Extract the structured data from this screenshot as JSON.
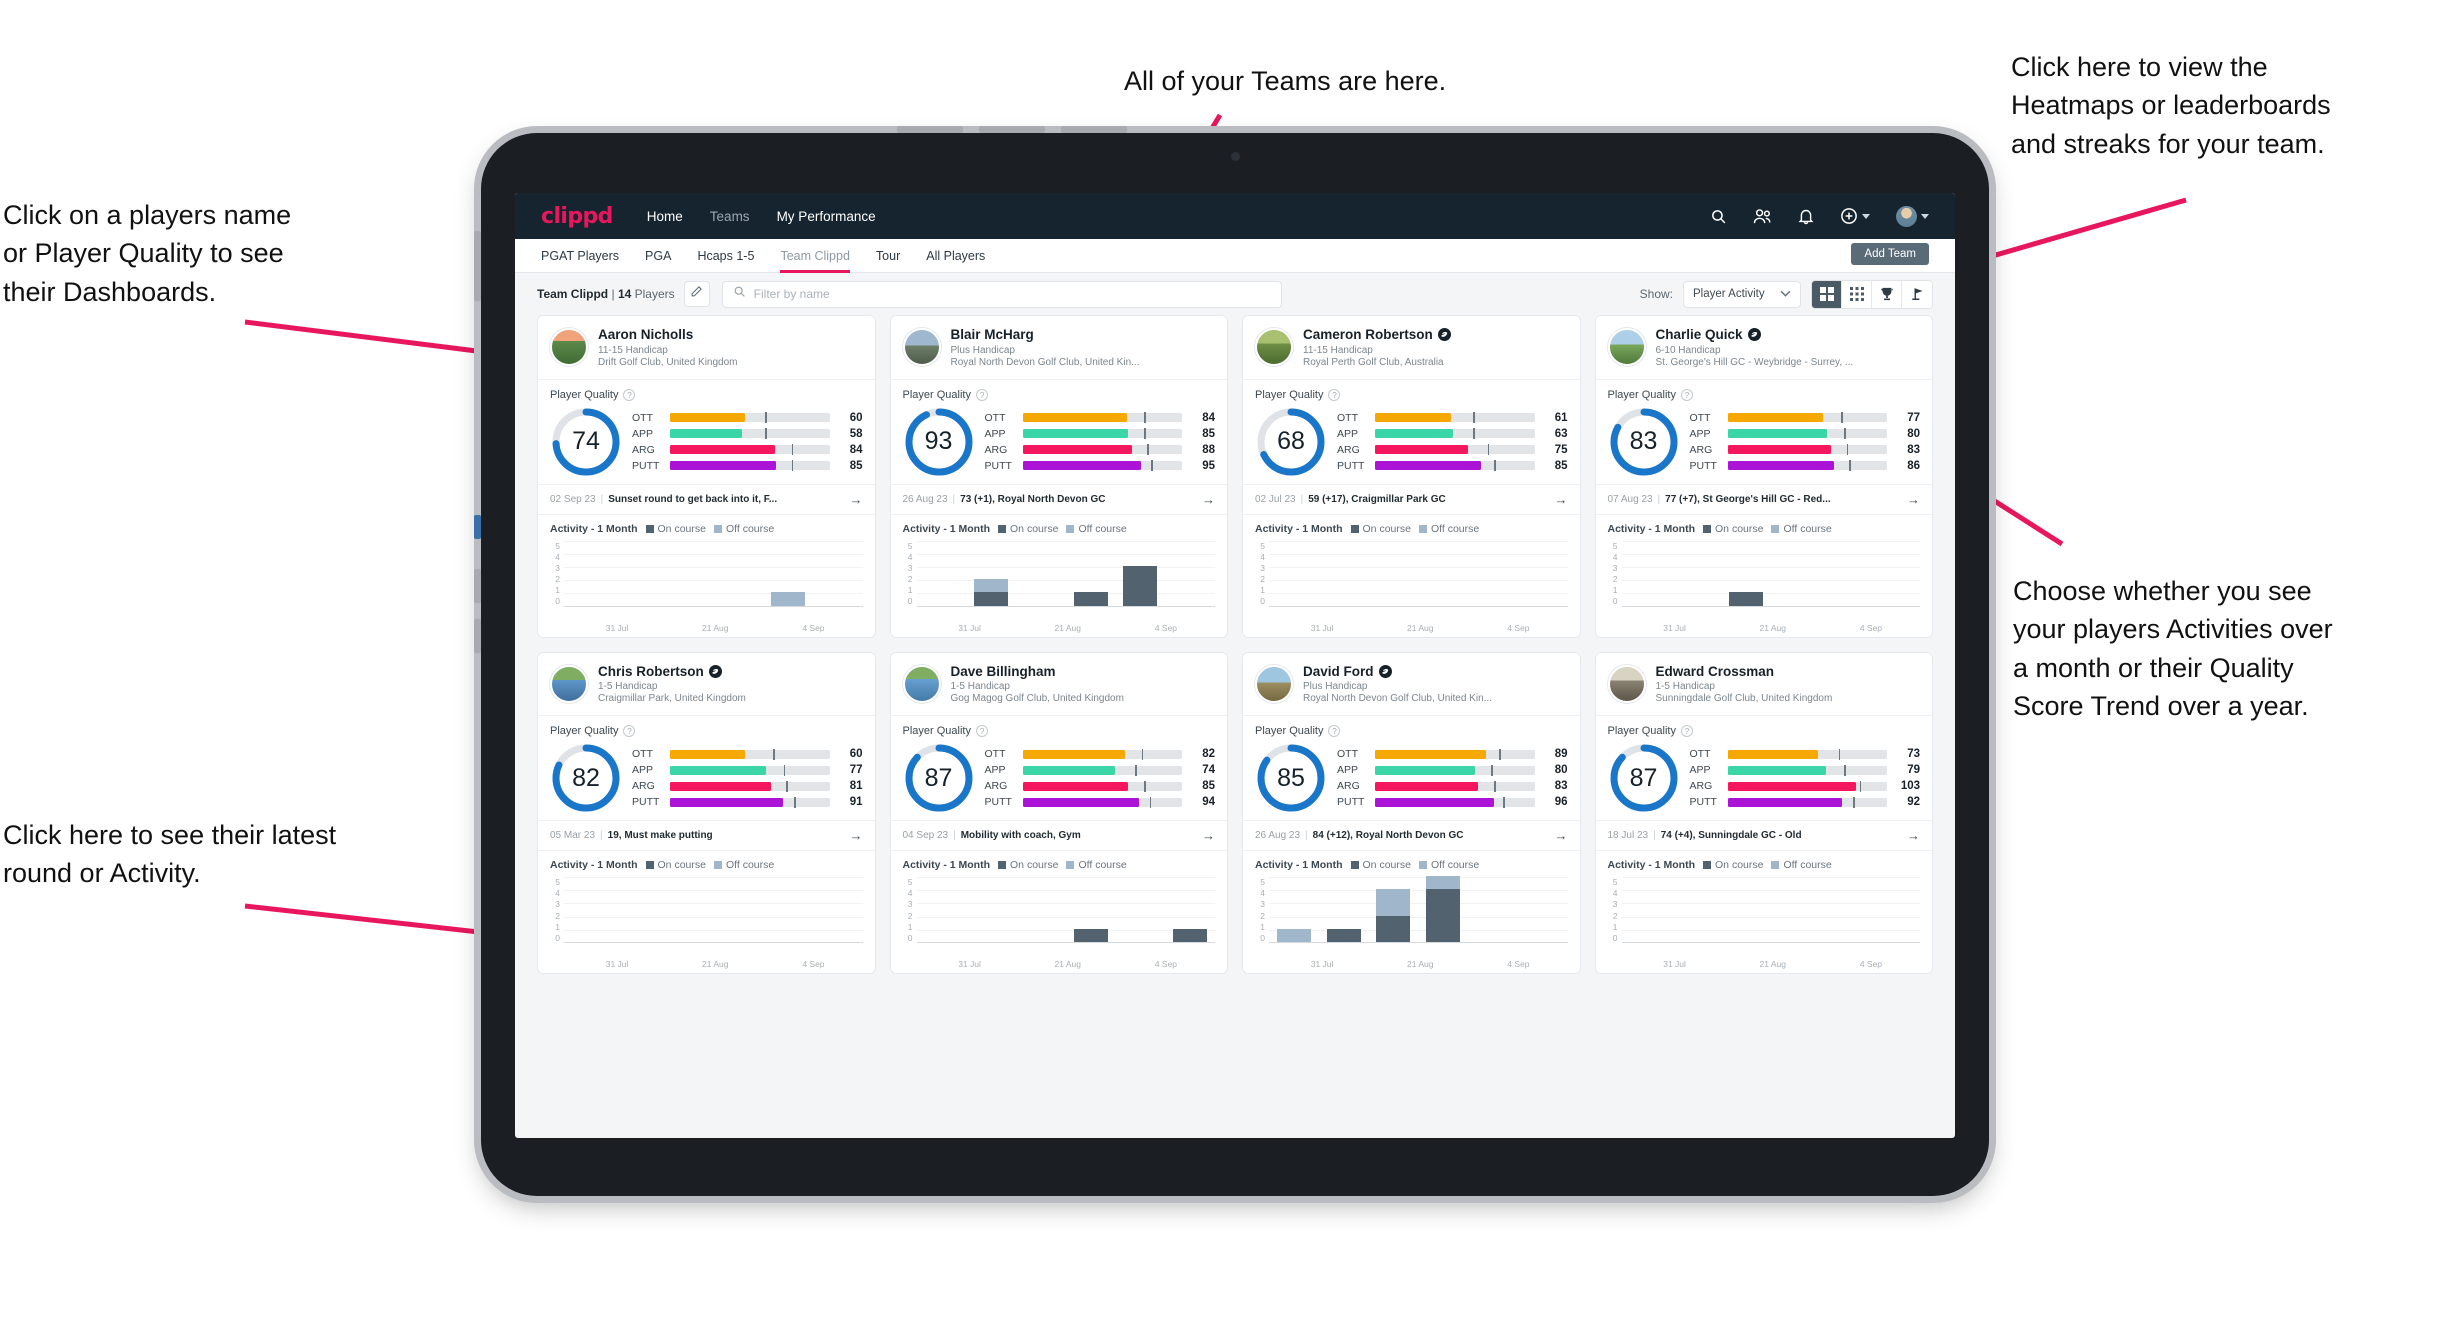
{
  "annotations": [
    {
      "id": "teams",
      "text": "All of your Teams are here."
    },
    {
      "id": "heatmaps",
      "text": "Click here to view the\nHeatmaps or leaderboards\nand streaks for your team."
    },
    {
      "id": "players",
      "text": "Click on a players name\nor Player Quality to see\ntheir Dashboards."
    },
    {
      "id": "activity",
      "text": "Choose whether you see\nyour players Activities over\na month or their Quality\nScore Trend over a year."
    },
    {
      "id": "latest",
      "text": "Click here to see their latest\nround or Activity."
    }
  ],
  "topnav": {
    "logo": "clippd",
    "links": [
      {
        "label": "Home",
        "active": true
      },
      {
        "label": "Teams",
        "active": false
      },
      {
        "label": "My Performance",
        "active": true
      }
    ],
    "icons": [
      "search-icon",
      "people-icon",
      "bell-icon",
      "plus-circle-icon",
      "avatar-icon"
    ]
  },
  "subnav": {
    "tabs": [
      {
        "label": "PGAT Players",
        "active": false
      },
      {
        "label": "PGA",
        "active": false
      },
      {
        "label": "Hcaps 1-5",
        "active": false
      },
      {
        "label": "Team Clippd",
        "active": true
      },
      {
        "label": "Tour",
        "active": false
      },
      {
        "label": "All Players",
        "active": false
      }
    ],
    "add_team_label": "Add Team"
  },
  "toolbar": {
    "team_name": "Team Clippd",
    "separator": "|",
    "player_count": "14",
    "players_word": "Players",
    "edit_icon": "pencil-icon",
    "search_placeholder": "Filter by name",
    "search_value": "",
    "show_label": "Show:",
    "show_value": "Player Activity",
    "views": [
      {
        "name": "grid-large-view",
        "active": true
      },
      {
        "name": "grid-small-view",
        "active": false
      },
      {
        "name": "trophy-view",
        "active": false
      },
      {
        "name": "flag-view",
        "active": false
      }
    ]
  },
  "card_labels": {
    "player_quality": "Player Quality",
    "activity": "Activity - 1 Month",
    "legend_on": "On course",
    "legend_off": "Off course",
    "metrics": [
      "OTT",
      "APP",
      "ARG",
      "PUTT"
    ],
    "x_labels": [
      "31 Jul",
      "21 Aug",
      "4 Sep"
    ],
    "y_labels": [
      "5",
      "4",
      "3",
      "2",
      "1",
      "0"
    ]
  },
  "colors": {
    "brand": "#e8175d",
    "nav_bg": "#16242f",
    "ring": "#1a76c8",
    "ott": "#f5a800",
    "app": "#3ad6a8",
    "arg": "#f5175e",
    "putt": "#ab13d6",
    "on_course": "#53626f",
    "off_course": "#9fb6cb"
  },
  "players": [
    {
      "name": "Aaron Nicholls",
      "verified": false,
      "handicap": "11-15 Handicap",
      "club": "Drift Golf Club, United Kingdom",
      "score": 74,
      "avatar": "linear-gradient(#f0a27a 0 32%, #5d8a4a 32%, #3f6b34)",
      "bars": [
        {
          "metric": "OTT",
          "value": 60,
          "tick": 72
        },
        {
          "metric": "APP",
          "value": 58,
          "tick": 72
        },
        {
          "metric": "ARG",
          "value": 84,
          "tick": 92
        },
        {
          "metric": "PUTT",
          "value": 85,
          "tick": 92
        }
      ],
      "round_date": "02 Sep 23",
      "round_text": "Sunset round to get back into it, F...",
      "activity": [
        {
          "on": 0,
          "off": 0
        },
        {
          "on": 0,
          "off": 0
        },
        {
          "on": 0,
          "off": 0
        },
        {
          "on": 0,
          "off": 0
        },
        {
          "on": 0,
          "off": 1
        },
        {
          "on": 0,
          "off": 0
        }
      ]
    },
    {
      "name": "Blair McHarg",
      "verified": false,
      "handicap": "Plus Handicap",
      "club": "Royal North Devon Golf Club, United Kin...",
      "score": 93,
      "avatar": "linear-gradient(#9fb8cf 0 45%, #6e7f6a 45%, #4e5c4b)",
      "bars": [
        {
          "metric": "OTT",
          "value": 84,
          "tick": 92
        },
        {
          "metric": "APP",
          "value": 85,
          "tick": 92
        },
        {
          "metric": "ARG",
          "value": 88,
          "tick": 94
        },
        {
          "metric": "PUTT",
          "value": 95,
          "tick": 97
        }
      ],
      "round_date": "26 Aug 23",
      "round_text": "73 (+1), Royal North Devon GC",
      "activity": [
        {
          "on": 0,
          "off": 0
        },
        {
          "on": 1,
          "off": 1
        },
        {
          "on": 0,
          "off": 0
        },
        {
          "on": 1,
          "off": 0
        },
        {
          "on": 3,
          "off": 0
        },
        {
          "on": 0,
          "off": 0
        }
      ]
    },
    {
      "name": "Cameron Robertson",
      "verified": true,
      "handicap": "11-15 Handicap",
      "club": "Royal Perth Golf Club, Australia",
      "score": 68,
      "avatar": "linear-gradient(#a8c070 0 40%, #6e8f45 40%, #4b6b30)",
      "bars": [
        {
          "metric": "OTT",
          "value": 61,
          "tick": 74
        },
        {
          "metric": "APP",
          "value": 63,
          "tick": 74
        },
        {
          "metric": "ARG",
          "value": 75,
          "tick": 85
        },
        {
          "metric": "PUTT",
          "value": 85,
          "tick": 90
        }
      ],
      "round_date": "02 Jul 23",
      "round_text": "59 (+17), Craigmillar Park GC",
      "activity": [
        {
          "on": 0,
          "off": 0
        },
        {
          "on": 0,
          "off": 0
        },
        {
          "on": 0,
          "off": 0
        },
        {
          "on": 0,
          "off": 0
        },
        {
          "on": 0,
          "off": 0
        },
        {
          "on": 0,
          "off": 0
        }
      ]
    },
    {
      "name": "Charlie Quick",
      "verified": true,
      "handicap": "6-10 Handicap",
      "club": "St. George's Hill GC - Weybridge - Surrey, ...",
      "score": 83,
      "avatar": "linear-gradient(#aecfe8 0 42%, #7aa85c 42%, #4f7a3c)",
      "bars": [
        {
          "metric": "OTT",
          "value": 77,
          "tick": 86
        },
        {
          "metric": "APP",
          "value": 80,
          "tick": 88
        },
        {
          "metric": "ARG",
          "value": 83,
          "tick": 90
        },
        {
          "metric": "PUTT",
          "value": 86,
          "tick": 92
        }
      ],
      "round_date": "07 Aug 23",
      "round_text": "77 (+7), St George's Hill GC - Red...",
      "activity": [
        {
          "on": 0,
          "off": 0
        },
        {
          "on": 0,
          "off": 0
        },
        {
          "on": 1,
          "off": 0
        },
        {
          "on": 0,
          "off": 0
        },
        {
          "on": 0,
          "off": 0
        },
        {
          "on": 0,
          "off": 0
        }
      ]
    },
    {
      "name": "Chris Robertson",
      "verified": true,
      "handicap": "1-5 Handicap",
      "club": "Craigmillar Park, United Kingdom",
      "score": 82,
      "avatar": "linear-gradient(#7fae62 0 38%, #5f96c9 38%, #3f6e9c)",
      "bars": [
        {
          "metric": "OTT",
          "value": 60,
          "tick": 78
        },
        {
          "metric": "APP",
          "value": 77,
          "tick": 86
        },
        {
          "metric": "ARG",
          "value": 81,
          "tick": 88
        },
        {
          "metric": "PUTT",
          "value": 91,
          "tick": 94
        }
      ],
      "round_date": "05 Mar 23",
      "round_text": "19, Must make putting",
      "activity": [
        {
          "on": 0,
          "off": 0
        },
        {
          "on": 0,
          "off": 0
        },
        {
          "on": 0,
          "off": 0
        },
        {
          "on": 0,
          "off": 0
        },
        {
          "on": 0,
          "off": 0
        },
        {
          "on": 0,
          "off": 0
        }
      ]
    },
    {
      "name": "Dave Billingham",
      "verified": false,
      "handicap": "1-5 Handicap",
      "club": "Gog Magog Golf Club, United Kingdom",
      "score": 87,
      "avatar": "linear-gradient(#7fae62 0 36%, #66a0d0 36%, #437aa8)",
      "bars": [
        {
          "metric": "OTT",
          "value": 82,
          "tick": 90
        },
        {
          "metric": "APP",
          "value": 74,
          "tick": 85
        },
        {
          "metric": "ARG",
          "value": 85,
          "tick": 92
        },
        {
          "metric": "PUTT",
          "value": 94,
          "tick": 96
        }
      ],
      "round_date": "04 Sep 23",
      "round_text": "Mobility with coach, Gym",
      "activity": [
        {
          "on": 0,
          "off": 0
        },
        {
          "on": 0,
          "off": 0
        },
        {
          "on": 0,
          "off": 0
        },
        {
          "on": 1,
          "off": 0
        },
        {
          "on": 0,
          "off": 0
        },
        {
          "on": 1,
          "off": 0
        }
      ]
    },
    {
      "name": "David Ford",
      "verified": true,
      "handicap": "Plus Handicap",
      "club": "Royal North Devon Golf Club, United Kin...",
      "score": 85,
      "avatar": "linear-gradient(#9fc6e0 0 46%, #9c8f63 46%, #74683f)",
      "bars": [
        {
          "metric": "OTT",
          "value": 89,
          "tick": 94
        },
        {
          "metric": "APP",
          "value": 80,
          "tick": 88
        },
        {
          "metric": "ARG",
          "value": 83,
          "tick": 90
        },
        {
          "metric": "PUTT",
          "value": 96,
          "tick": 97
        }
      ],
      "round_date": "26 Aug 23",
      "round_text": "84 (+12), Royal North Devon GC",
      "activity": [
        {
          "on": 0,
          "off": 1
        },
        {
          "on": 1,
          "off": 0
        },
        {
          "on": 2,
          "off": 2
        },
        {
          "on": 4,
          "off": 1
        },
        {
          "on": 0,
          "off": 0
        },
        {
          "on": 0,
          "off": 0
        }
      ]
    },
    {
      "name": "Edward Crossman",
      "verified": false,
      "handicap": "1-5 Handicap",
      "club": "Sunningdale Golf Club, United Kingdom",
      "score": 87,
      "avatar": "linear-gradient(#d9d3c4 0 40%, #8a8272 40%, #5d5649)",
      "bars": [
        {
          "metric": "OTT",
          "value": 73,
          "tick": 84
        },
        {
          "metric": "APP",
          "value": 79,
          "tick": 88
        },
        {
          "metric": "ARG",
          "value": 103,
          "tick": 100
        },
        {
          "metric": "PUTT",
          "value": 92,
          "tick": 95
        }
      ],
      "round_date": "18 Jul 23",
      "round_text": "74 (+4), Sunningdale GC - Old",
      "activity": [
        {
          "on": 0,
          "off": 0
        },
        {
          "on": 0,
          "off": 0
        },
        {
          "on": 0,
          "off": 0
        },
        {
          "on": 0,
          "off": 0
        },
        {
          "on": 0,
          "off": 0
        },
        {
          "on": 0,
          "off": 0
        }
      ]
    }
  ]
}
